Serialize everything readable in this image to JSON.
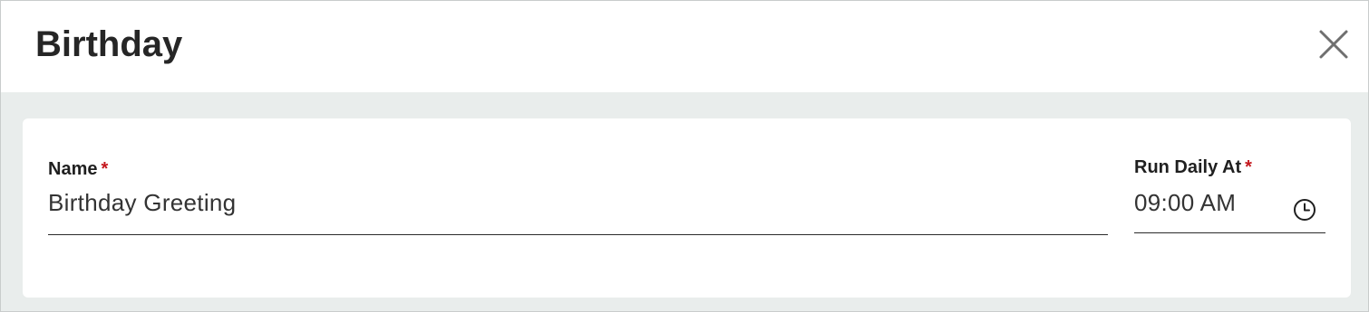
{
  "dialog": {
    "title": "Birthday",
    "close_icon": "close-icon"
  },
  "form": {
    "name": {
      "label": "Name",
      "required_mark": "*",
      "value": "Birthday Greeting"
    },
    "run_daily_at": {
      "label": "Run Daily At",
      "required_mark": "*",
      "value": "09:00 AM",
      "icon": "clock-icon"
    }
  },
  "colors": {
    "required": "#c4161c",
    "background": "#e9edec",
    "card": "#ffffff",
    "title": "#262626"
  }
}
